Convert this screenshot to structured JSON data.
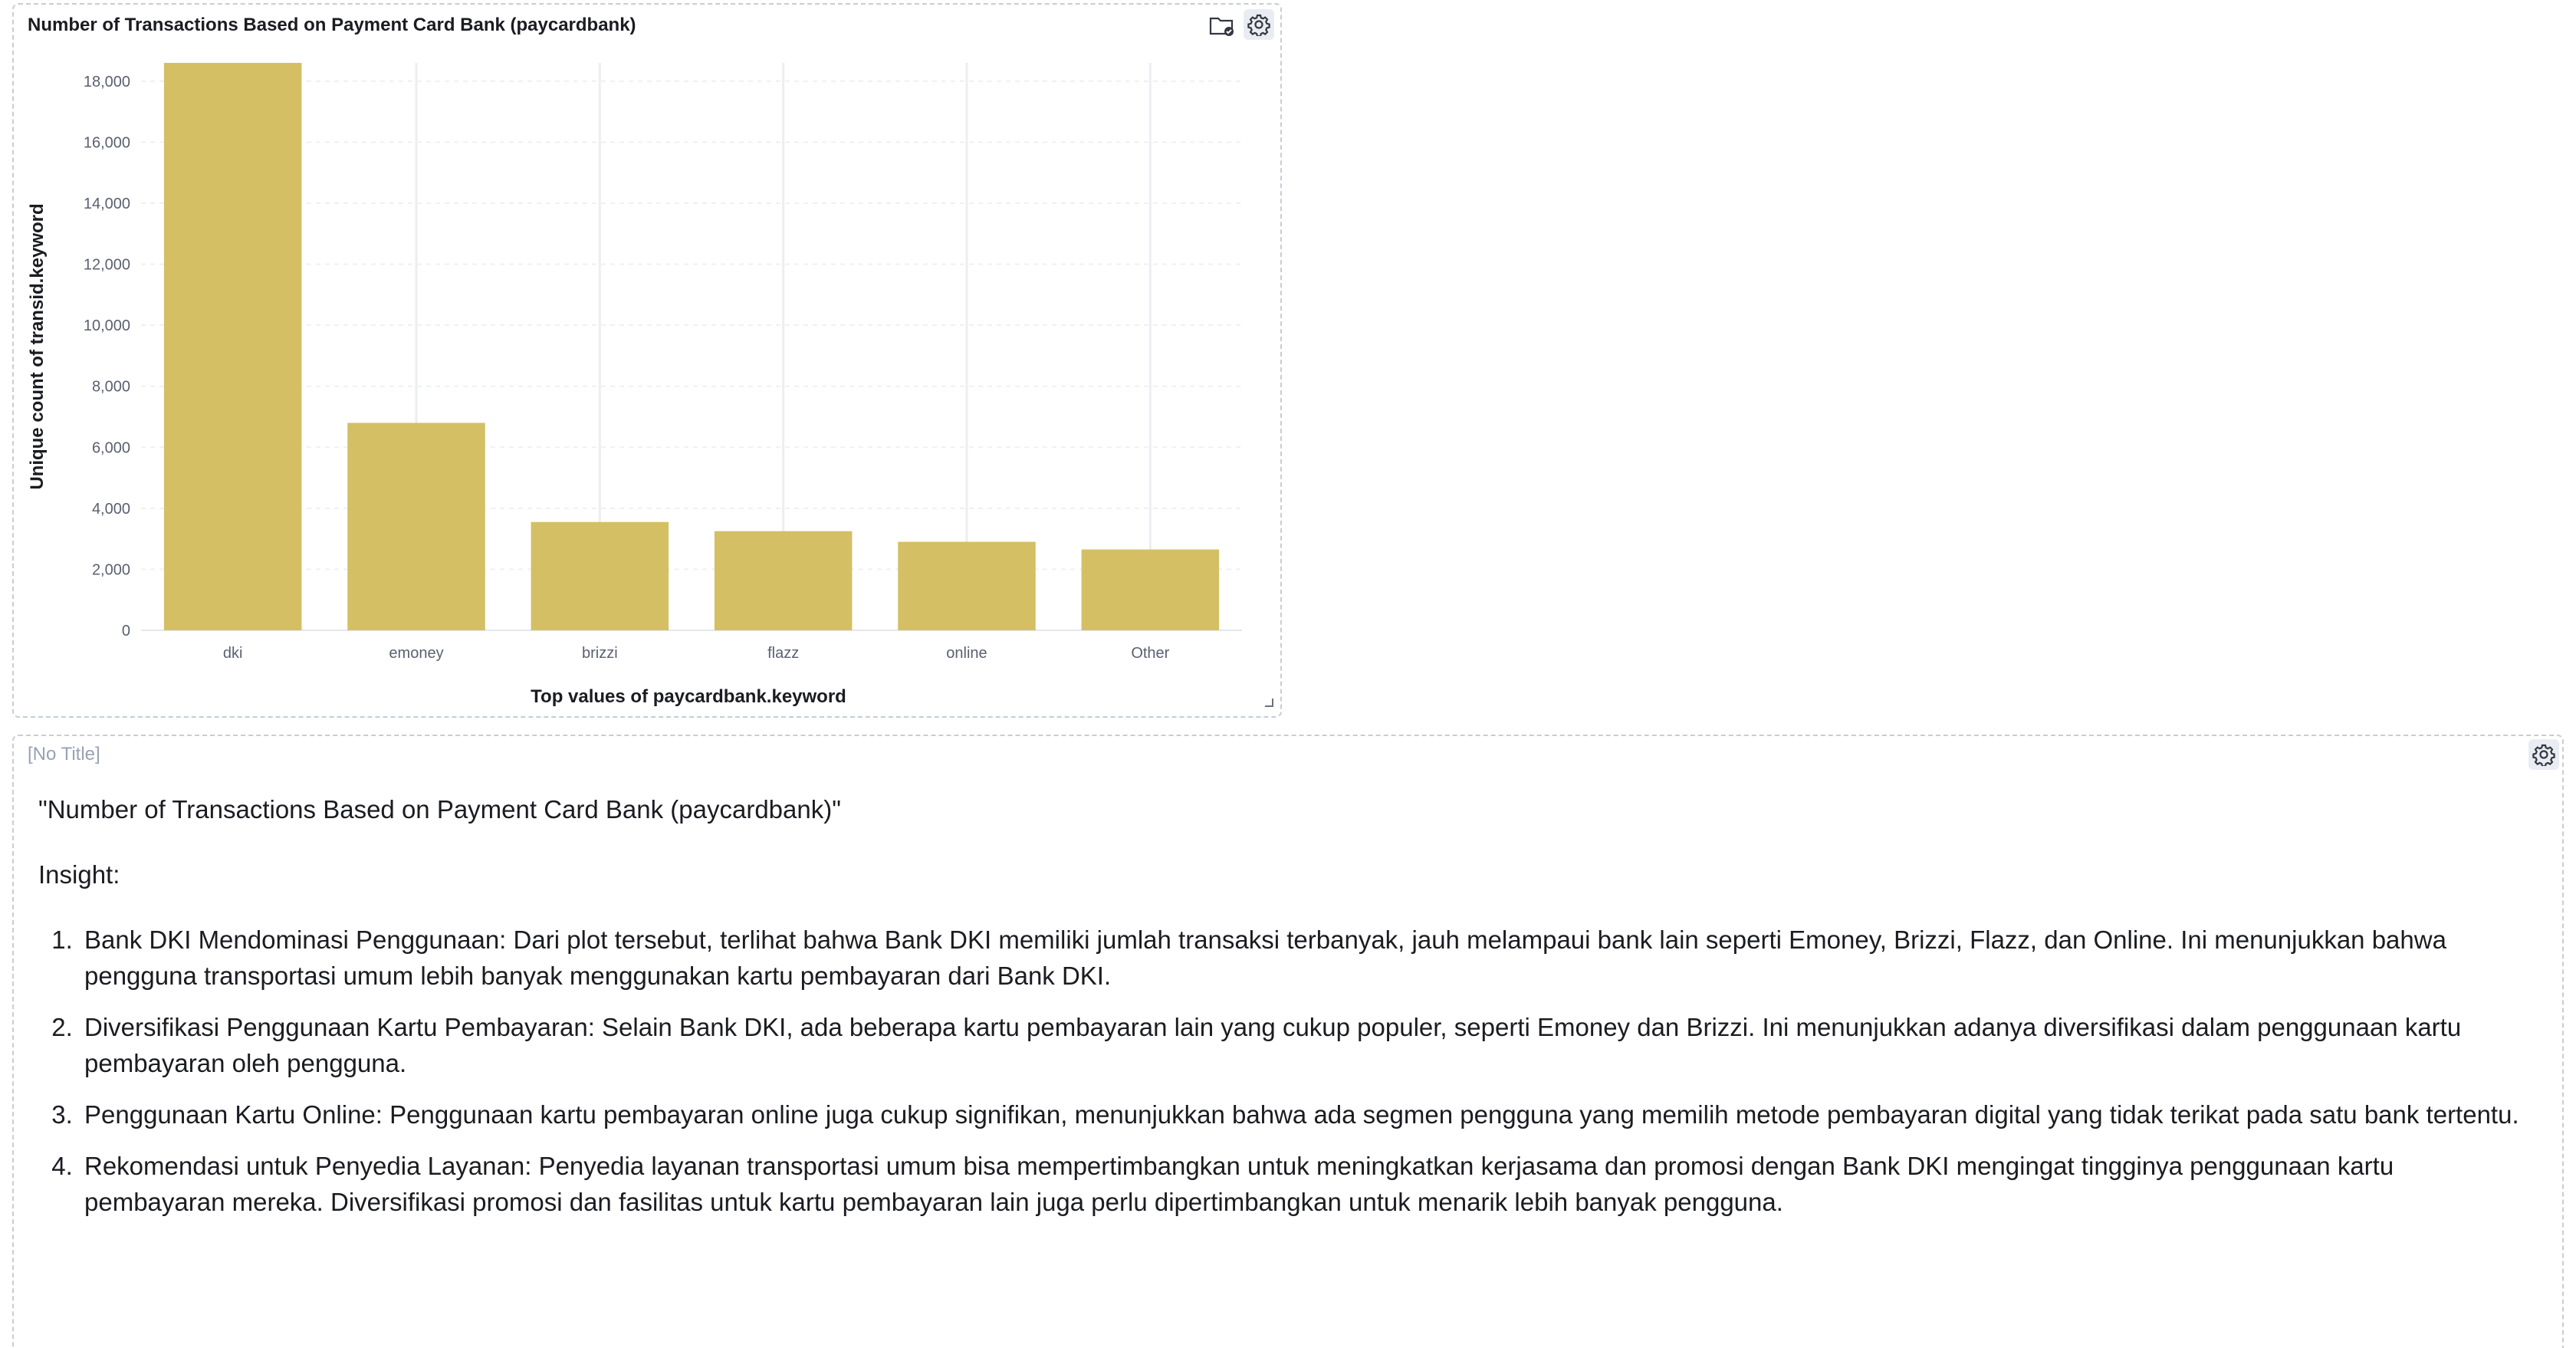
{
  "chart_panel": {
    "title": "Number of Transactions Based on Payment Card Bank (paycardbank)",
    "icons": [
      "folder-check-icon",
      "gear-icon"
    ]
  },
  "chart_data": {
    "type": "bar",
    "title": "Number of Transactions Based on Payment Card Bank (paycardbank)",
    "xlabel": "Top values of paycardbank.keyword",
    "ylabel": "Unique count of transid.keyword",
    "categories": [
      "dki",
      "emoney",
      "brizzi",
      "flazz",
      "online",
      "Other"
    ],
    "values": [
      18700,
      6800,
      3550,
      3250,
      2900,
      2650
    ],
    "ylim": [
      0,
      18600
    ],
    "yticks": [
      0,
      2000,
      4000,
      6000,
      8000,
      10000,
      12000,
      14000,
      16000,
      18000
    ],
    "ytick_labels": [
      "0",
      "2,000",
      "4,000",
      "6,000",
      "8,000",
      "10,000",
      "12,000",
      "14,000",
      "16,000",
      "18,000"
    ],
    "bar_color": "#d4bf64",
    "grid": true
  },
  "text_panel": {
    "title": "[No Title]",
    "heading": "\"Number of Transactions Based on Payment Card Bank (paycardbank)\"",
    "insight_label": "Insight:",
    "items": [
      "Bank DKI Mendominasi Penggunaan: Dari plot tersebut, terlihat bahwa Bank DKI memiliki jumlah transaksi terbanyak, jauh melampaui bank lain seperti Emoney, Brizzi, Flazz, dan Online. Ini menunjukkan bahwa pengguna transportasi umum lebih banyak menggunakan kartu pembayaran dari Bank DKI.",
      "Diversifikasi Penggunaan Kartu Pembayaran: Selain Bank DKI, ada beberapa kartu pembayaran lain yang cukup populer, seperti Emoney dan Brizzi. Ini menunjukkan adanya diversifikasi dalam penggunaan kartu pembayaran oleh pengguna.",
      "Penggunaan Kartu Online: Penggunaan kartu pembayaran online juga cukup signifikan, menunjukkan bahwa ada segmen pengguna yang memilih metode pembayaran digital yang tidak terikat pada satu bank tertentu.",
      "Rekomendasi untuk Penyedia Layanan: Penyedia layanan transportasi umum bisa mempertimbangkan untuk meningkatkan kerjasama dan promosi dengan Bank DKI mengingat tingginya penggunaan kartu pembayaran mereka. Diversifikasi promosi dan fasilitas untuk kartu pembayaran lain juga perlu dipertimbangkan untuk menarik lebih banyak pengguna."
    ]
  }
}
